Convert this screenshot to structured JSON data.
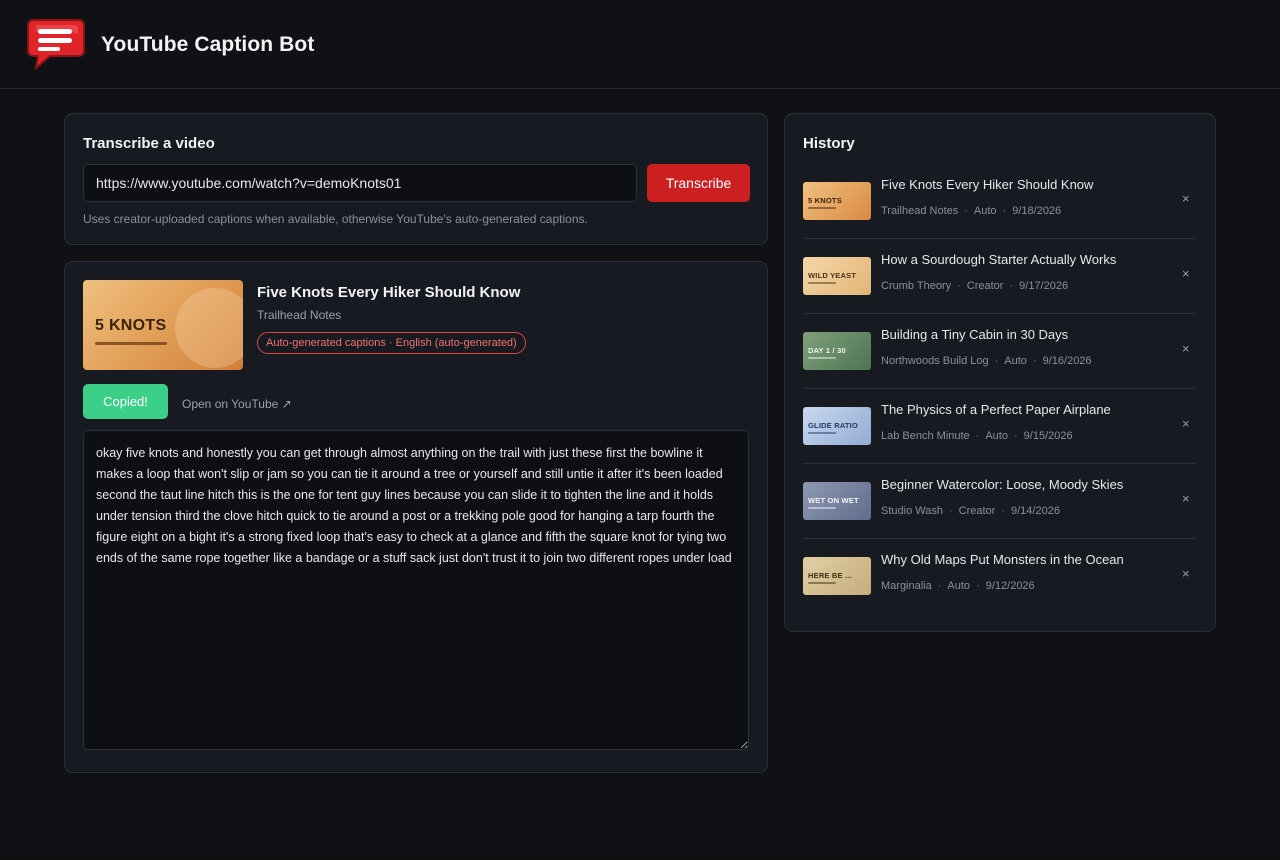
{
  "app": {
    "title": "YouTube Caption Bot",
    "logo_icon": "chat-bubble-lines-icon",
    "colors": {
      "background": "#0f1115",
      "card": "#171a20",
      "accent_red": "#cc1f1f",
      "success_green": "#3ccf88"
    }
  },
  "transcribe": {
    "heading": "Transcribe a video",
    "url_value": "https://www.youtube.com/watch?v=demoKnots01",
    "button_label": "Transcribe",
    "hint": "Uses creator-uploaded captions when available, otherwise YouTube's auto-generated captions."
  },
  "video": {
    "thumbnail_text": "5 KNOTS",
    "title": "Five Knots Every Hiker Should Know",
    "channel": "Trailhead Notes",
    "caption_badge": "Auto-generated captions · English (auto-generated)",
    "copy_button_label": "Copied!",
    "open_link_label": "Open on YouTube ↗",
    "transcript": "okay five knots and honestly you can get through almost anything on the trail with just these first the bowline it makes a loop that won't slip or jam so you can tie it around a tree or yourself and still untie it after it's been loaded second the taut line hitch this is the one for tent guy lines because you can slide it to tighten the line and it holds under tension third the clove hitch quick to tie around a post or a trekking pole good for hanging a tarp fourth the figure eight on a bight it's a strong fixed loop that's easy to check at a glance and fifth the square knot for tying two ends of the same rope together like a bandage or a stuff sack just don't trust it to join two different ropes under load"
  },
  "history": {
    "heading": "History",
    "close_glyph": "×",
    "items": [
      {
        "title": "Five Knots Every Hiker Should Know",
        "channel": "Trailhead Notes",
        "source": "Auto",
        "date": "9/18/2026",
        "thumb_text": "5 KNOTS",
        "thumb_colors": [
          "#f0c080",
          "#d98a44"
        ],
        "thumb_text_color": "#3a220c"
      },
      {
        "title": "How a Sourdough Starter Actually Works",
        "channel": "Crumb Theory",
        "source": "Creator",
        "date": "9/17/2026",
        "thumb_text": "WILD YEAST",
        "thumb_colors": [
          "#f3d7a8",
          "#e2b576"
        ],
        "thumb_text_color": "#4a3214"
      },
      {
        "title": "Building a Tiny Cabin in 30 Days",
        "channel": "Northwoods Build Log",
        "source": "Auto",
        "date": "9/16/2026",
        "thumb_text": "DAY 1 / 30",
        "thumb_colors": [
          "#7fa07a",
          "#4f7453"
        ],
        "thumb_text_color": "#f2f5ef"
      },
      {
        "title": "The Physics of a Perfect Paper Airplane",
        "channel": "Lab Bench Minute",
        "source": "Auto",
        "date": "9/15/2026",
        "thumb_text": "GLIDE RATIO",
        "thumb_colors": [
          "#c8d8ef",
          "#93acd3"
        ],
        "thumb_text_color": "#1d3a66"
      },
      {
        "title": "Beginner Watercolor: Loose, Moody Skies",
        "channel": "Studio Wash",
        "source": "Creator",
        "date": "9/14/2026",
        "thumb_text": "WET ON WET",
        "thumb_colors": [
          "#8d98b3",
          "#616d8c"
        ],
        "thumb_text_color": "#f4f5f9"
      },
      {
        "title": "Why Old Maps Put Monsters in the Ocean",
        "channel": "Marginalia",
        "source": "Auto",
        "date": "9/12/2026",
        "thumb_text": "HERE BE ...",
        "thumb_colors": [
          "#e2cfa4",
          "#c5ad7c"
        ],
        "thumb_text_color": "#3d2e14"
      }
    ]
  }
}
